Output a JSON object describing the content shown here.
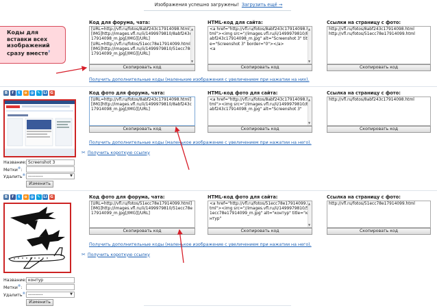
{
  "top": {
    "message": "Изображения успешно загружены!",
    "upload_more": "Загрузить ещё →"
  },
  "callout": {
    "text": "Коды для вставки всех изображений сразу вместе",
    "info": "?"
  },
  "common": {
    "forum_header": "Код для форума, чата:",
    "html_header": "HTML-код для сайта:",
    "links_header": "Ссылки на страницу с фото:",
    "forum_code": "[URL=http://vfl.ru/fotos/8abf243c17914098.html][IMG]http://images.vfl.ru/ii/1499979810/8abf243c17914098_m.jpg[/IMG][/URL]\n[URL=http://vfl.ru/fotos/51ecc78e17914099.html][IMG]http://images.vfl.ru/ii/1499979810/51ecc78e17914099_m.jpg[/IMG][/URL]",
    "html_code": "<a href=\"http://vfl.ru/fotos/8abf243c17914098.html\"><img src=\"//images.vfl.ru/ii/1499979810/8abf243c17914098_m.jpg\" alt=\"Screenshot 3\" title=\"Screenshot 3\" border=\"0\"></a>\n<a",
    "links": "http://vfl.ru/fotos/8abf243c17914098.html\nhttp://vfl.ru/fotos/51ecc78e17914099.html",
    "copy_label": "Скопировать код",
    "more_codes": "Получить дополнительные коды (маленькие изображения с увеличением при нажатии на них)."
  },
  "images": [
    {
      "forum_header": "Код фото для форума, чата:",
      "html_header": "HTML-код фото для сайта:",
      "link_header": "Ссылка на страницу с фото:",
      "forum_code": "[URL=http://vfl.ru/fotos/8abf243c17914098.html][IMG]http://images.vfl.ru/ii/1499979810/8abf243c17914098_m.jpg[/IMG][/URL]",
      "html_code": "<a href=\"http://vfl.ru/fotos/8abf243c17914098.html\"><img src=\"//images.vfl.ru/ii/1499979810/8abf243c17914098_m.jpg\" alt=\"Screenshot 3\"",
      "link": "http://vfl.ru/fotos/8abf243c17914098.html",
      "copy_label": "Скопировать код",
      "more_codes": "Получить дополнительные коды (маленькое изображение с увеличением при нажатии на него).",
      "short_link": "Получить короткую ссылку",
      "name_label": "Название:",
      "name_value": "Screenshot 3",
      "tags_label": "Метки",
      "delete_label": "Удалить",
      "delete_value": "----------",
      "change_label": "Изменить"
    },
    {
      "forum_header": "Код фото для форума, чата:",
      "html_header": "HTML-код фото для сайта:",
      "link_header": "Ссылка на страницу с фото:",
      "forum_code": "[URL=http://vfl.ru/fotos/51ecc78e17914099.html][IMG]http://images.vfl.ru/ii/1499979810/51ecc78e17914099_m.jpg[/IMG][/URL]",
      "html_code": "<a href=\"http://vfl.ru/fotos/51ecc78e17914099.html\"><img src=\"//images.vfl.ru/ii/1499979810/51ecc78e17914099_m.jpg\" alt=\"контур\" title=\"контур\"",
      "link": "http://vfl.ru/fotos/51ecc78e17914099.html",
      "copy_label": "Скопировать код",
      "more_codes": "Получить дополнительные коды (маленькое изображение с увеличением при нажатии на него).",
      "short_link": "Получить короткую ссылку",
      "name_label": "Название:",
      "name_value": "контур",
      "tags_label": "Метки",
      "delete_label": "Удалить",
      "delete_value": "----------",
      "change_label": "Изменить"
    }
  ],
  "share_icons": [
    {
      "name": "vk-icon",
      "glyph": "В",
      "color": "#4a76a8"
    },
    {
      "name": "facebook-icon",
      "glyph": "f",
      "color": "#3b5998"
    },
    {
      "name": "twitter-icon",
      "glyph": "t",
      "color": "#1da1f2"
    },
    {
      "name": "odnoklassniki-icon",
      "glyph": "о",
      "color": "#f7931e"
    },
    {
      "name": "mailru-icon",
      "glyph": "@",
      "color": "#168de2"
    },
    {
      "name": "livejournal-icon",
      "glyph": "✎",
      "color": "#00a0e0"
    },
    {
      "name": "liveinternet-icon",
      "glyph": "Li",
      "color": "#2b77c2"
    },
    {
      "name": "google-icon",
      "glyph": "G",
      "color": "#dd4b39"
    }
  ],
  "colors": {
    "link": "#1a5fb4",
    "callout_bg": "#ffd9de",
    "callout_border": "#d84a5a",
    "arrow": "#d71f2a",
    "thumb_border": "#cc2222"
  }
}
